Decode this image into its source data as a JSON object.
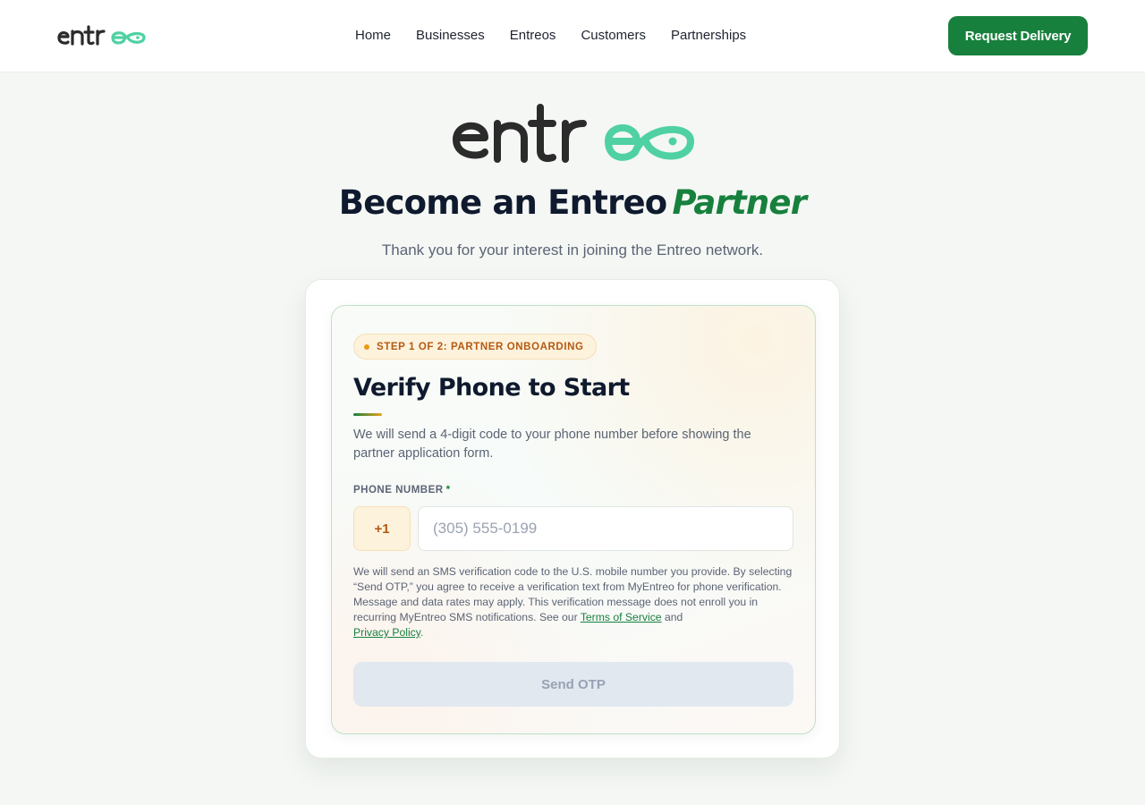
{
  "header": {
    "logo_text": "entreo",
    "nav": [
      "Home",
      "Businesses",
      "Entreos",
      "Customers",
      "Partnerships"
    ],
    "cta_label": "Request Delivery"
  },
  "hero": {
    "logo_text": "entreo",
    "title_main": "Become an Entreo",
    "title_accent": "Partner",
    "subtitle": "Thank you for your interest in joining the Entreo network."
  },
  "card": {
    "step_badge": "STEP 1 OF 2: PARTNER ONBOARDING",
    "title": "Verify Phone to Start",
    "description": "We will send a 4-digit code to your phone number before showing the partner application form.",
    "phone_label": "PHONE NUMBER",
    "required_mark": "*",
    "country_code": "+1",
    "phone_placeholder": "(305) 555-0199",
    "phone_value": "",
    "legal_text_1": "We will send an SMS verification code to the U.S. mobile number you provide. By selecting “Send OTP,” you agree to receive a verification text from MyEntreo for phone verification. Message and data rates may apply. This verification message does not enroll you in recurring MyEntreo SMS notifications. See our",
    "terms_link": "Terms of Service",
    "legal_and": "and",
    "privacy_link": "Privacy Policy",
    "legal_end": ".",
    "send_button": "Send OTP"
  },
  "colors": {
    "brand_green": "#17803d",
    "logo_dark": "#2b2b2b",
    "logo_mint": "#4fd1a3",
    "step_orange": "#b45a12",
    "disabled_button": "#e1e8f0"
  },
  "icons": [
    "entreo-logo-icon",
    "status-dot-icon"
  ]
}
